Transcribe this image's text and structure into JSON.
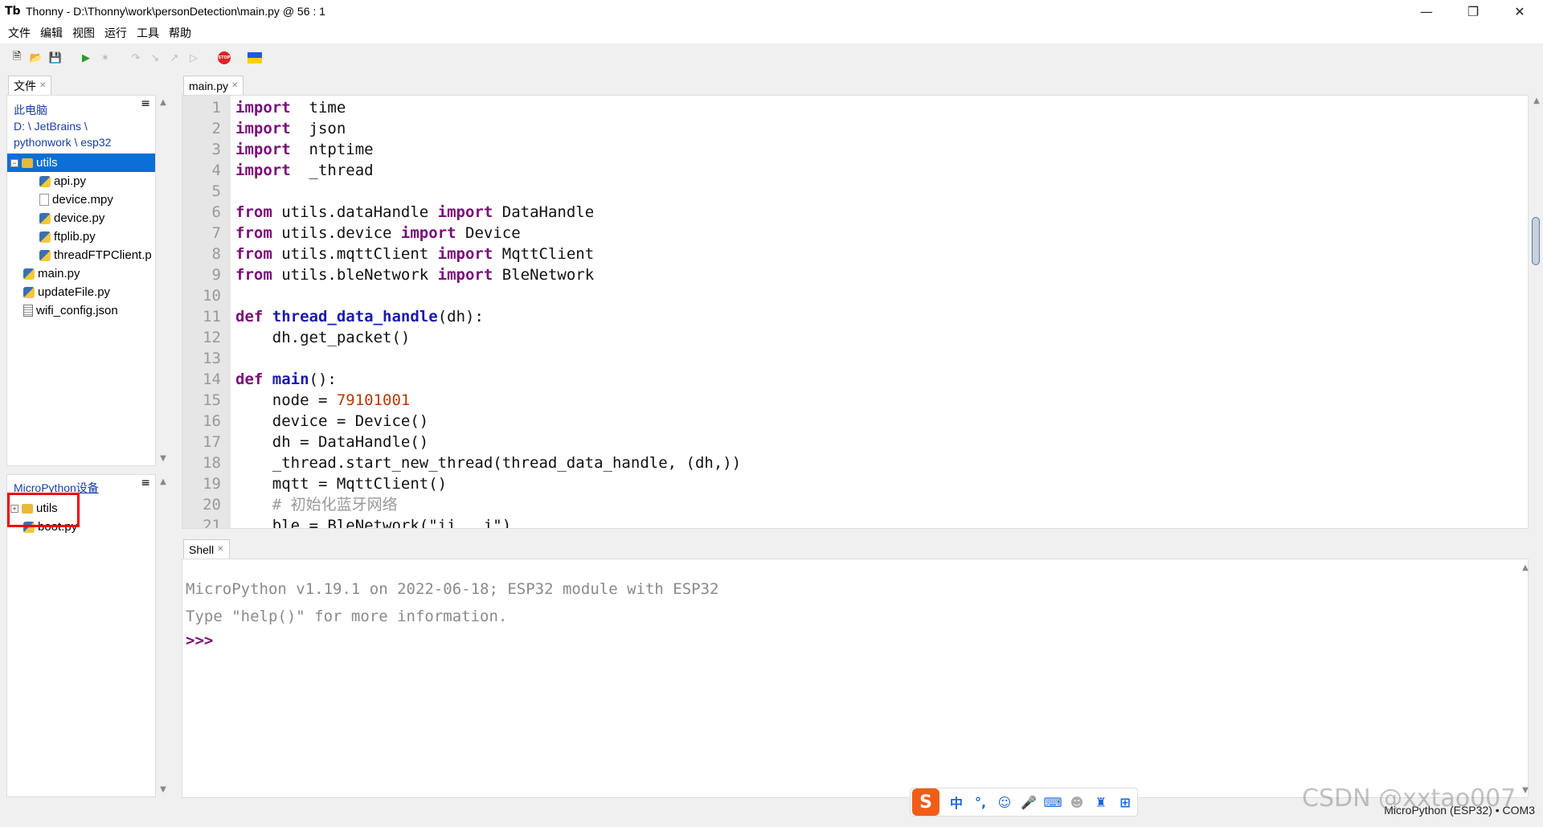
{
  "window": {
    "title": "Thonny  -  D:\\Thonny\\work\\personDetection\\main.py  @  56 : 1"
  },
  "menu": [
    "文件",
    "编辑",
    "视图",
    "运行",
    "工具",
    "帮助"
  ],
  "files_panel": {
    "tab_label": "文件",
    "path_line1": "此电脑",
    "path_line2": "D: \\ JetBrains \\",
    "path_line3": "pythonwork \\ esp32",
    "items": [
      {
        "name": "utils",
        "type": "folder"
      },
      {
        "name": "api.py",
        "type": "py"
      },
      {
        "name": "device.mpy",
        "type": "file"
      },
      {
        "name": "device.py",
        "type": "py"
      },
      {
        "name": "ftplib.py",
        "type": "py"
      },
      {
        "name": "threadFTPClient.p",
        "type": "py"
      },
      {
        "name": "main.py",
        "type": "py"
      },
      {
        "name": "updateFile.py",
        "type": "py"
      },
      {
        "name": "wifi_config.json",
        "type": "json"
      }
    ]
  },
  "device_panel": {
    "title": "MicroPython设备",
    "items": [
      {
        "name": "utils",
        "type": "folder"
      },
      {
        "name": "boot.py",
        "type": "py"
      }
    ]
  },
  "editor": {
    "tab_label": "main.py",
    "line_numbers": [
      "1",
      "2",
      "3",
      "4",
      "5",
      "6",
      "7",
      "8",
      "9",
      "10",
      "11",
      "12",
      "13",
      "14",
      "15",
      "16",
      "17",
      "18",
      "19",
      "20",
      "21"
    ],
    "lines": [
      [
        [
          "kw",
          "import"
        ],
        [
          "",
          "  time"
        ]
      ],
      [
        [
          "kw",
          "import"
        ],
        [
          "",
          "  json"
        ]
      ],
      [
        [
          "kw",
          "import"
        ],
        [
          "",
          "  ntptime"
        ]
      ],
      [
        [
          "kw",
          "import"
        ],
        [
          "",
          "  _thread"
        ]
      ],
      [],
      [
        [
          "kw",
          "from"
        ],
        [
          "",
          " utils.dataHandle "
        ],
        [
          "kw",
          "import"
        ],
        [
          "",
          " DataHandle"
        ]
      ],
      [
        [
          "kw",
          "from"
        ],
        [
          "",
          " utils.device "
        ],
        [
          "kw",
          "import"
        ],
        [
          "",
          " Device"
        ]
      ],
      [
        [
          "kw",
          "from"
        ],
        [
          "",
          " utils.mqttClient "
        ],
        [
          "kw",
          "import"
        ],
        [
          "",
          " MqttClient"
        ]
      ],
      [
        [
          "kw",
          "from"
        ],
        [
          "",
          " utils.bleNetwork "
        ],
        [
          "kw",
          "import"
        ],
        [
          "",
          " BleNetwork"
        ]
      ],
      [],
      [
        [
          "kw",
          "def"
        ],
        [
          "",
          " "
        ],
        [
          "fn",
          "thread_data_handle"
        ],
        [
          "",
          "(dh):"
        ]
      ],
      [
        [
          "",
          "    dh.get_packet()"
        ]
      ],
      [],
      [
        [
          "kw",
          "def"
        ],
        [
          "",
          " "
        ],
        [
          "fn",
          "main"
        ],
        [
          "",
          "():"
        ]
      ],
      [
        [
          "",
          "    node = "
        ],
        [
          "num",
          "79101001"
        ]
      ],
      [
        [
          "",
          "    device = Device()"
        ]
      ],
      [
        [
          "",
          "    dh = DataHandle()"
        ]
      ],
      [
        [
          "",
          "    _thread.start_new_thread(thread_data_handle, (dh,))"
        ]
      ],
      [
        [
          "",
          "    mqtt = MqttClient()"
        ]
      ],
      [
        [
          "cm",
          "    # 初始化蓝牙网络"
        ]
      ],
      [
        [
          "",
          "    ble = BleNetwork(\"ii   i\")"
        ]
      ]
    ]
  },
  "shell": {
    "tab_label": "Shell",
    "line1": "MicroPython v1.19.1 on 2022-06-18; ESP32 module with ESP32",
    "line2": "Type \"help()\" for more information.",
    "prompt": ">>>"
  },
  "status": {
    "text": "MicroPython (ESP32)  •  COM3"
  },
  "ime": {
    "logo": "S",
    "lang": "中"
  },
  "watermark": "CSDN @xxtao007"
}
